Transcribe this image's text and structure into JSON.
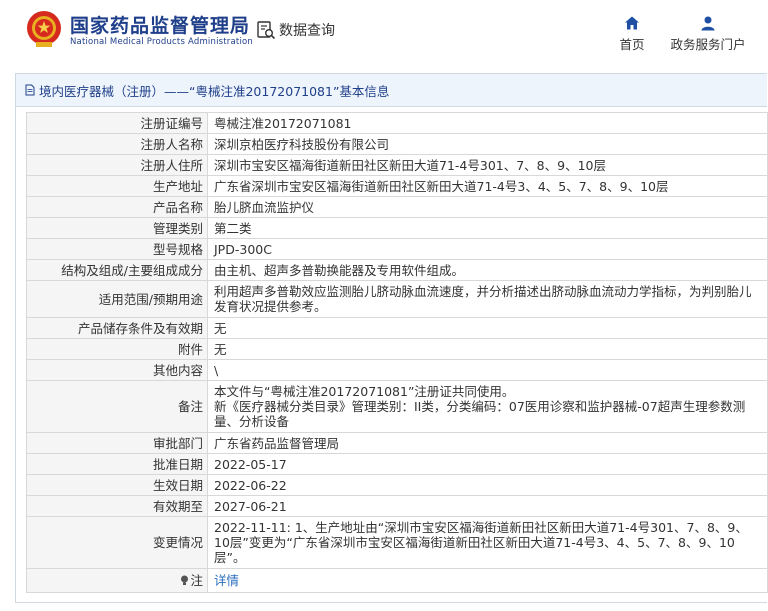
{
  "header": {
    "logo_cn": "国家药品监督管理局",
    "logo_en": "National Medical Products Administration",
    "search_label": "数据查询",
    "nav": [
      {
        "label": "首页",
        "icon": "home-icon"
      },
      {
        "label": "政务服务门户",
        "icon": "user-icon"
      }
    ]
  },
  "breadcrumb": "境内医疗器械（注册）——“粤械注准20172071081”基本信息",
  "rows": [
    {
      "label": "注册证编号",
      "value": "粤械注准20172071081"
    },
    {
      "label": "注册人名称",
      "value": "深圳京柏医疗科技股份有限公司"
    },
    {
      "label": "注册人住所",
      "value": "深圳市宝安区福海街道新田社区新田大道71-4号301、7、8、9、10层"
    },
    {
      "label": "生产地址",
      "value": "广东省深圳市宝安区福海街道新田社区新田大道71-4号3、4、5、7、8、9、10层"
    },
    {
      "label": "产品名称",
      "value": "胎儿脐血流监护仪"
    },
    {
      "label": "管理类别",
      "value": "第二类"
    },
    {
      "label": "型号规格",
      "value": "JPD-300C"
    },
    {
      "label": "结构及组成/主要组成成分",
      "value": "由主机、超声多普勒换能器及专用软件组成。"
    },
    {
      "label": "适用范围/预期用途",
      "value": "利用超声多普勒效应监测胎儿脐动脉血流速度，并分析描述出脐动脉血流动力学指标，为判别胎儿发育状况提供参考。"
    },
    {
      "label": "产品储存条件及有效期",
      "value": "无"
    },
    {
      "label": "附件",
      "value": "无"
    },
    {
      "label": "其他内容",
      "value": "\\"
    },
    {
      "label": "备注",
      "value": "本文件与“粤械注准20172071081”注册证共同使用。\n新《医疗器械分类目录》管理类别：II类，分类编码：07医用诊察和监护器械-07超声生理参数测量、分析设备"
    },
    {
      "label": "审批部门",
      "value": "广东省药品监督管理局"
    },
    {
      "label": "批准日期",
      "value": "2022-05-17"
    },
    {
      "label": "生效日期",
      "value": "2022-06-22"
    },
    {
      "label": "有效期至",
      "value": "2027-06-21"
    },
    {
      "label": "变更情况",
      "value": "2022-11-11: 1、生产地址由“深圳市宝安区福海街道新田社区新田大道71-4号301、7、8、9、10层”变更为“广东省深圳市宝安区福海街道新田社区新田大道71-4号3、4、5、7、8、9、10层”。"
    }
  ],
  "note": {
    "label": "注",
    "link": "详情"
  }
}
